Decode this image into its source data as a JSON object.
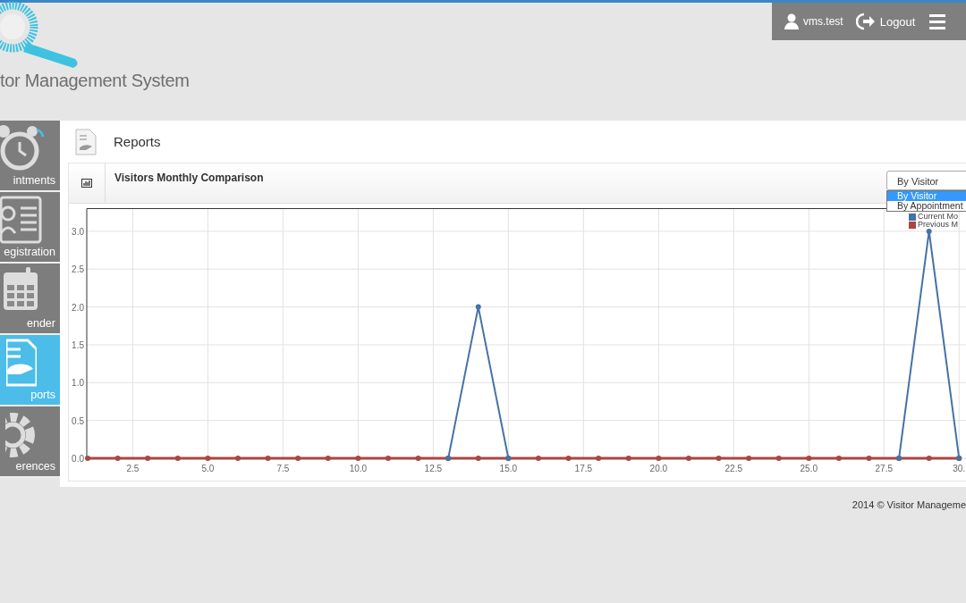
{
  "header": {
    "app_name": "tor Management System",
    "user": "vms.test",
    "logout": "Logout"
  },
  "sidebar": {
    "items": [
      {
        "label": "intments",
        "selected": false
      },
      {
        "label": "egistration",
        "selected": false
      },
      {
        "label": "ender",
        "selected": false
      },
      {
        "label": "ports",
        "selected": true
      },
      {
        "label": "erences",
        "selected": false
      }
    ]
  },
  "page": {
    "title": "Reports"
  },
  "panel": {
    "title": "Visitors Monthly Comparison",
    "dropdown": {
      "value": "By Visitor",
      "expanded": true,
      "options": [
        {
          "label": "By Visitor",
          "selected": true
        },
        {
          "label": "By Appointment",
          "selected": false
        }
      ]
    },
    "chart_data": {
      "type": "line",
      "x": [
        1,
        2,
        3,
        4,
        5,
        6,
        7,
        8,
        9,
        10,
        11,
        12,
        13,
        14,
        15,
        16,
        17,
        18,
        19,
        20,
        21,
        22,
        23,
        24,
        25,
        26,
        27,
        28,
        29,
        30
      ],
      "series": [
        {
          "name": "Current Mo",
          "color": "#4572a7",
          "marker": true,
          "values": [
            null,
            null,
            null,
            null,
            null,
            null,
            null,
            null,
            null,
            null,
            null,
            null,
            0,
            2,
            0,
            null,
            null,
            null,
            null,
            null,
            null,
            null,
            null,
            null,
            null,
            null,
            null,
            0,
            3,
            0
          ]
        },
        {
          "name": "Previous M",
          "color": "#aa4643",
          "marker": true,
          "values": [
            0,
            0,
            0,
            0,
            0,
            0,
            0,
            0,
            0,
            0,
            0,
            0,
            0,
            0,
            0,
            0,
            0,
            0,
            0,
            0,
            0,
            0,
            0,
            0,
            0,
            0,
            0,
            0,
            0,
            0
          ]
        }
      ],
      "xlim": [
        1,
        30.2
      ],
      "ylim": [
        0,
        3.3
      ],
      "grid": true,
      "legend": true,
      "xticks": [
        {
          "value": 2.5,
          "label": "2.5"
        },
        {
          "value": 5,
          "label": "5.0"
        },
        {
          "value": 7.5,
          "label": "7.5"
        },
        {
          "value": 10,
          "label": "10.0"
        },
        {
          "value": 12.5,
          "label": "12.5"
        },
        {
          "value": 15,
          "label": "15.0"
        },
        {
          "value": 17.5,
          "label": "17.5"
        },
        {
          "value": 20,
          "label": "20.0"
        },
        {
          "value": 22.5,
          "label": "22.5"
        },
        {
          "value": 25,
          "label": "25.0"
        },
        {
          "value": 27.5,
          "label": "27.5"
        },
        {
          "value": 30,
          "label": "30."
        }
      ],
      "yticks": [
        {
          "value": 0,
          "label": "0.0"
        },
        {
          "value": 0.5,
          "label": "0.5"
        },
        {
          "value": 1,
          "label": "1.0"
        },
        {
          "value": 1.5,
          "label": "1.5"
        },
        {
          "value": 2,
          "label": "2.0"
        },
        {
          "value": 2.5,
          "label": "2.5"
        },
        {
          "value": 3,
          "label": "3.0"
        }
      ]
    }
  },
  "footer": "2014 © Visitor Manageme"
}
